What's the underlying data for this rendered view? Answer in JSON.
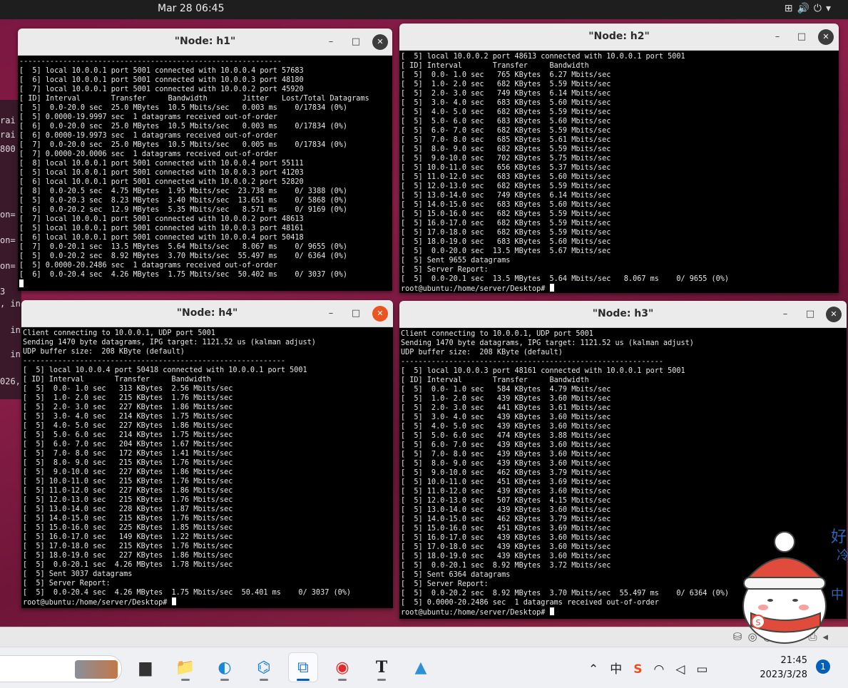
{
  "topbar": {
    "clock": "Mar 28  06:45"
  },
  "background_left_lines": [
    "rai",
    "rai",
    "800",
    "on=",
    "on=",
    "on=",
    "3",
    ", in",
    "  in",
    "  in",
    "026,"
  ],
  "windows": {
    "h1": {
      "title": "\"Node: h1\"",
      "lines": [
        "------------------------------------------------------------",
        "[  5] local 10.0.0.1 port 5001 connected with 10.0.0.4 port 57683",
        "[  6] local 10.0.0.1 port 5001 connected with 10.0.0.3 port 48180",
        "[  7] local 10.0.0.1 port 5001 connected with 10.0.0.2 port 45920",
        "[ ID] Interval       Transfer     Bandwidth        Jitter   Lost/Total Datagrams",
        "[  5]  0.0-20.0 sec  25.0 MBytes  10.5 Mbits/sec   0.003 ms    0/17834 (0%)",
        "[  5] 0.0000-19.9997 sec  1 datagrams received out-of-order",
        "[  6]  0.0-20.0 sec  25.0 MBytes  10.5 Mbits/sec   0.003 ms    0/17834 (0%)",
        "[  6] 0.0000-19.9973 sec  1 datagrams received out-of-order",
        "[  7]  0.0-20.0 sec  25.0 MBytes  10.5 Mbits/sec   0.005 ms    0/17834 (0%)",
        "[  7] 0.0000-20.0006 sec  1 datagrams received out-of-order",
        "[  8] local 10.0.0.1 port 5001 connected with 10.0.0.4 port 55111",
        "[  5] local 10.0.0.1 port 5001 connected with 10.0.0.3 port 41203",
        "[  6] local 10.0.0.1 port 5001 connected with 10.0.0.2 port 52820",
        "[  8]  0.0-20.5 sec  4.75 MBytes  1.95 Mbits/sec  23.738 ms    0/ 3388 (0%)",
        "[  5]  0.0-20.3 sec  8.23 MBytes  3.40 Mbits/sec  13.651 ms    0/ 5868 (0%)",
        "[  6]  0.0-20.2 sec  12.9 MBytes  5.35 Mbits/sec   8.571 ms    0/ 9169 (0%)",
        "[  7] local 10.0.0.1 port 5001 connected with 10.0.0.2 port 48613",
        "[  5] local 10.0.0.1 port 5001 connected with 10.0.0.3 port 48161",
        "[  6] local 10.0.0.1 port 5001 connected with 10.0.0.4 port 50418",
        "[  7]  0.0-20.1 sec  13.5 MBytes  5.64 Mbits/sec   8.067 ms    0/ 9655 (0%)",
        "[  5]  0.0-20.2 sec  8.92 MBytes  3.70 Mbits/sec  55.497 ms    0/ 6364 (0%)",
        "[  5] 0.0000-20.2486 sec  1 datagrams received out-of-order",
        "[  6]  0.0-20.4 sec  4.26 MBytes  1.75 Mbits/sec  50.402 ms    0/ 3037 (0%)"
      ]
    },
    "h2": {
      "title": "\"Node: h2\"",
      "lines": [
        "[  5] local 10.0.0.2 port 48613 connected with 10.0.0.1 port 5001",
        "[ ID] Interval       Transfer     Bandwidth",
        "[  5]  0.0- 1.0 sec   765 KBytes  6.27 Mbits/sec",
        "[  5]  1.0- 2.0 sec   682 KBytes  5.59 Mbits/sec",
        "[  5]  2.0- 3.0 sec   749 KBytes  6.14 Mbits/sec",
        "[  5]  3.0- 4.0 sec   683 KBytes  5.60 Mbits/sec",
        "[  5]  4.0- 5.0 sec   682 KBytes  5.59 Mbits/sec",
        "[  5]  5.0- 6.0 sec   683 KBytes  5.60 Mbits/sec",
        "[  5]  6.0- 7.0 sec   682 KBytes  5.59 Mbits/sec",
        "[  5]  7.0- 8.0 sec   685 KBytes  5.61 Mbits/sec",
        "[  5]  8.0- 9.0 sec   682 KBytes  5.59 Mbits/sec",
        "[  5]  9.0-10.0 sec   702 KBytes  5.75 Mbits/sec",
        "[  5] 10.0-11.0 sec   656 KBytes  5.37 Mbits/sec",
        "[  5] 11.0-12.0 sec   683 KBytes  5.60 Mbits/sec",
        "[  5] 12.0-13.0 sec   682 KBytes  5.59 Mbits/sec",
        "[  5] 13.0-14.0 sec   749 KBytes  6.14 Mbits/sec",
        "[  5] 14.0-15.0 sec   683 KBytes  5.60 Mbits/sec",
        "[  5] 15.0-16.0 sec   682 KBytes  5.59 Mbits/sec",
        "[  5] 16.0-17.0 sec   682 KBytes  5.59 Mbits/sec",
        "[  5] 17.0-18.0 sec   682 KBytes  5.59 Mbits/sec",
        "[  5] 18.0-19.0 sec   683 KBytes  5.60 Mbits/sec",
        "[  5]  0.0-20.0 sec  13.5 MBytes  5.67 Mbits/sec",
        "[  5] Sent 9655 datagrams",
        "[  5] Server Report:",
        "[  5]  0.0-20.1 sec  13.5 MBytes  5.64 Mbits/sec   8.067 ms    0/ 9655 (0%)"
      ],
      "prompt": "root@ubuntu:/home/server/Desktop# "
    },
    "h4": {
      "title": "\"Node: h4\"",
      "lines": [
        "Client connecting to 10.0.0.1, UDP port 5001",
        "Sending 1470 byte datagrams, IPG target: 1121.52 us (kalman adjust)",
        "UDP buffer size:  208 KByte (default)",
        "------------------------------------------------------------",
        "[  5] local 10.0.0.4 port 50418 connected with 10.0.0.1 port 5001",
        "[ ID] Interval       Transfer     Bandwidth",
        "[  5]  0.0- 1.0 sec   313 KBytes  2.56 Mbits/sec",
        "[  5]  1.0- 2.0 sec   215 KBytes  1.76 Mbits/sec",
        "[  5]  2.0- 3.0 sec   227 KBytes  1.86 Mbits/sec",
        "[  5]  3.0- 4.0 sec   214 KBytes  1.75 Mbits/sec",
        "[  5]  4.0- 5.0 sec   227 KBytes  1.86 Mbits/sec",
        "[  5]  5.0- 6.0 sec   214 KBytes  1.75 Mbits/sec",
        "[  5]  6.0- 7.0 sec   204 KBytes  1.67 Mbits/sec",
        "[  5]  7.0- 8.0 sec   172 KBytes  1.41 Mbits/sec",
        "[  5]  8.0- 9.0 sec   215 KBytes  1.76 Mbits/sec",
        "[  5]  9.0-10.0 sec   227 KBytes  1.86 Mbits/sec",
        "[  5] 10.0-11.0 sec   215 KBytes  1.76 Mbits/sec",
        "[  5] 11.0-12.0 sec   227 KBytes  1.86 Mbits/sec",
        "[  5] 12.0-13.0 sec   215 KBytes  1.76 Mbits/sec",
        "[  5] 13.0-14.0 sec   228 KBytes  1.87 Mbits/sec",
        "[  5] 14.0-15.0 sec   215 KBytes  1.76 Mbits/sec",
        "[  5] 15.0-16.0 sec   225 KBytes  1.85 Mbits/sec",
        "[  5] 16.0-17.0 sec   149 KBytes  1.22 Mbits/sec",
        "[  5] 17.0-18.0 sec   215 KBytes  1.76 Mbits/sec",
        "[  5] 18.0-19.0 sec   227 KBytes  1.86 Mbits/sec",
        "[  5]  0.0-20.1 sec  4.26 MBytes  1.78 Mbits/sec",
        "[  5] Sent 3037 datagrams",
        "[  5] Server Report:",
        "[  5]  0.0-20.4 sec  4.26 MBytes  1.75 Mbits/sec  50.401 ms    0/ 3037 (0%)"
      ],
      "prompt": "root@ubuntu:/home/server/Desktop# "
    },
    "h3": {
      "title": "\"Node: h3\"",
      "lines": [
        "Client connecting to 10.0.0.1, UDP port 5001",
        "Sending 1470 byte datagrams, IPG target: 1121.52 us (kalman adjust)",
        "UDP buffer size:  208 KByte (default)",
        "------------------------------------------------------------",
        "[  5] local 10.0.0.3 port 48161 connected with 10.0.0.1 port 5001",
        "[ ID] Interval       Transfer     Bandwidth",
        "[  5]  0.0- 1.0 sec   584 KBytes  4.79 Mbits/sec",
        "[  5]  1.0- 2.0 sec   439 KBytes  3.60 Mbits/sec",
        "[  5]  2.0- 3.0 sec   441 KBytes  3.61 Mbits/sec",
        "[  5]  3.0- 4.0 sec   439 KBytes  3.60 Mbits/sec",
        "[  5]  4.0- 5.0 sec   439 KBytes  3.60 Mbits/sec",
        "[  5]  5.0- 6.0 sec   474 KBytes  3.88 Mbits/sec",
        "[  5]  6.0- 7.0 sec   439 KBytes  3.60 Mbits/sec",
        "[  5]  7.0- 8.0 sec   439 KBytes  3.60 Mbits/sec",
        "[  5]  8.0- 9.0 sec   439 KBytes  3.60 Mbits/sec",
        "[  5]  9.0-10.0 sec   462 KBytes  3.79 Mbits/sec",
        "[  5] 10.0-11.0 sec   451 KBytes  3.69 Mbits/sec",
        "[  5] 11.0-12.0 sec   439 KBytes  3.60 Mbits/sec",
        "[  5] 12.0-13.0 sec   507 KBytes  4.15 Mbits/sec",
        "[  5] 13.0-14.0 sec   439 KBytes  3.60 Mbits/sec",
        "[  5] 14.0-15.0 sec   462 KBytes  3.79 Mbits/sec",
        "[  5] 15.0-16.0 sec   451 KBytes  3.69 Mbits/sec",
        "[  5] 16.0-17.0 sec   439 KBytes  3.60 Mbits/sec",
        "[  5] 17.0-18.0 sec   439 KBytes  3.60 Mbits/sec",
        "[  5] 18.0-19.0 sec   439 KBytes  3.60 Mbits/sec",
        "[  5]  0.0-20.1 sec  8.92 MBytes  3.72 Mbits/sec",
        "[  5] Sent 6364 datagrams",
        "[  5] Server Report:",
        "[  5]  0.0-20.2 sec  8.92 MBytes  3.70 Mbits/sec  55.497 ms    0/ 6364 (0%)",
        "[  5] 0.0000-20.2486 sec  1 datagrams received out-of-order"
      ],
      "prompt": "root@ubuntu:/home/server/Desktop# "
    }
  },
  "window_controls": {
    "minimize": "–",
    "maximize": "□",
    "close": "✕"
  },
  "sticker": {
    "text_1": "好",
    "text_2": "冷",
    "text_3": "中",
    "badge": "S"
  },
  "taskbar": {
    "apps": [
      {
        "icon": "task-view-icon",
        "glyph": "▆"
      },
      {
        "icon": "file-explorer-icon",
        "glyph": "📁"
      },
      {
        "icon": "edge-browser-icon",
        "glyph": "◐"
      },
      {
        "icon": "vscode-icon",
        "glyph": "⌬"
      },
      {
        "icon": "virtualbox-icon",
        "glyph": "⧉"
      },
      {
        "icon": "netease-music-icon",
        "glyph": "◉"
      },
      {
        "icon": "typora-icon",
        "glyph": "T"
      },
      {
        "icon": "photos-icon",
        "glyph": "▲"
      }
    ],
    "time": "21:45",
    "date": "2023/3/28",
    "notifications": "1",
    "ime_char": "中",
    "sogou_char": "S"
  }
}
